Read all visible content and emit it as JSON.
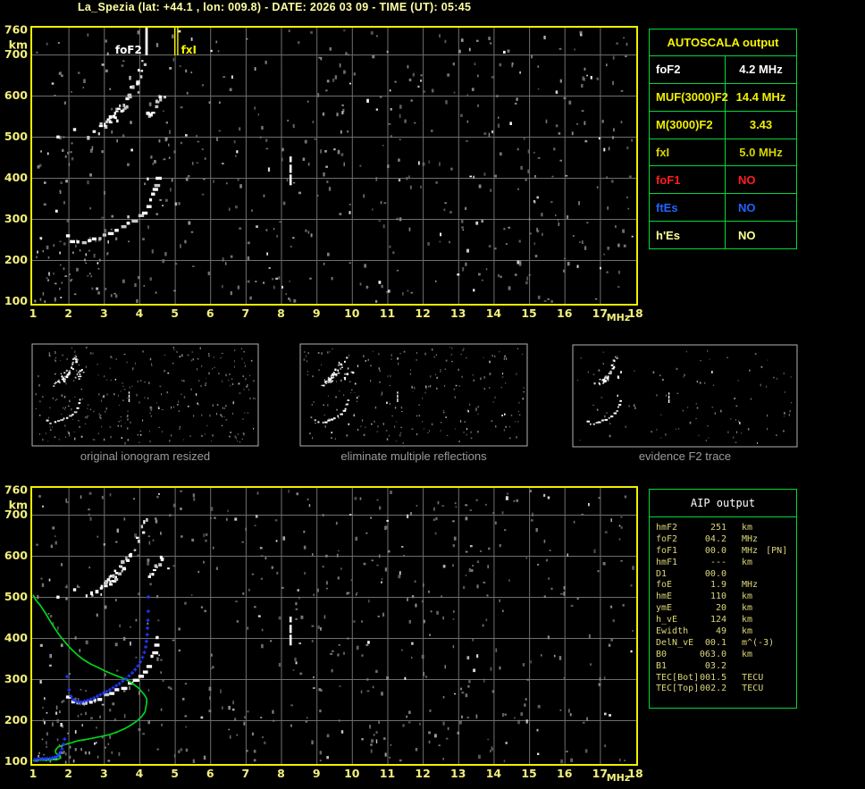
{
  "title": "La_Spezia (lat: +44.1 , lon: 009.8) - DATE: 2026 03 09 - TIME (UT): 05:45",
  "colors": {
    "background": "#000000",
    "title": "#ffffa2",
    "plot_border": "#f0f000",
    "grid": "#6e6e6e",
    "axis_labels": "#f3ef7c",
    "trace": "#ffffff",
    "trace_dim": "#c8c8c8",
    "noise": "#8c8c8c",
    "green_profile": "#00d41e",
    "blue_model": "#2238ff",
    "table_border": "#00d83c",
    "thumb_border": "#b2b2b2",
    "caption": "#9b9b9b",
    "fof2_marker": "#ffffff",
    "fxi_marker": "#f0f000",
    "interference": "#ffffff"
  },
  "autoscala_table": {
    "header": "AUTOSCALA output",
    "rows": [
      {
        "label": "foF2",
        "value": "4.2 MHz",
        "color": "#ffffff",
        "align": "center"
      },
      {
        "label": "MUF(3000)F2",
        "value": "14.4 MHz",
        "color": "#f0f000",
        "align": "center"
      },
      {
        "label": "M(3000)F2",
        "value": "3.43",
        "color": "#f0f000",
        "align": "center"
      },
      {
        "label": "fxI",
        "value": "5.0 MHz",
        "color": "#d6d600",
        "align": "center"
      },
      {
        "label": "foF1",
        "value": "NO",
        "color": "#ff1e1e",
        "align": "left"
      },
      {
        "label": "ftEs",
        "value": "NO",
        "color": "#1e64ff",
        "align": "left"
      },
      {
        "label": "h'Es",
        "value": "NO",
        "color": "#ffff96",
        "align": "left"
      }
    ]
  },
  "aip_table": {
    "header": "AIP output",
    "rows": [
      {
        "name": "hmF2",
        "value": "251",
        "unit": "km",
        "note": ""
      },
      {
        "name": "foF2",
        "value": "04.2",
        "unit": "MHz",
        "note": ""
      },
      {
        "name": "foF1",
        "value": "00.0",
        "unit": "MHz",
        "note": "[PN]"
      },
      {
        "name": "hmF1",
        "value": "---",
        "unit": "km",
        "note": ""
      },
      {
        "name": "D1",
        "value": "00.0",
        "unit": "",
        "note": ""
      },
      {
        "name": "foE",
        "value": "1.9",
        "unit": "MHz",
        "note": ""
      },
      {
        "name": "hmE",
        "value": "110",
        "unit": "km",
        "note": ""
      },
      {
        "name": "ymE",
        "value": "20",
        "unit": "km",
        "note": ""
      },
      {
        "name": "h_vE",
        "value": "124",
        "unit": "km",
        "note": ""
      },
      {
        "name": "Ewidth",
        "value": "49",
        "unit": "km",
        "note": ""
      },
      {
        "name": "DelN_vE",
        "value": "00.1",
        "unit": "m^(-3)",
        "note": ""
      },
      {
        "name": "B0",
        "value": "063.0",
        "unit": "km",
        "note": ""
      },
      {
        "name": "B1",
        "value": "03.2",
        "unit": "",
        "note": ""
      },
      {
        "name": "TEC[Bot]",
        "value": "001.5",
        "unit": "TECU",
        "note": ""
      },
      {
        "name": "TEC[Top]",
        "value": "002.2",
        "unit": "TECU",
        "note": ""
      }
    ]
  },
  "thumbnails": [
    {
      "caption": "original ionogram resized"
    },
    {
      "caption": "eliminate multiple reflections"
    },
    {
      "caption": "evidence F2 trace"
    }
  ],
  "chart_data": {
    "type": "scatter",
    "title": "ionogram: virtual height vs sounding frequency",
    "x_axis": {
      "label": "MHz",
      "min": 1,
      "max": 18,
      "ticks": [
        1,
        2,
        3,
        4,
        5,
        6,
        7,
        8,
        9,
        10,
        11,
        12,
        13,
        14,
        15,
        16,
        17,
        18
      ]
    },
    "y_axis": {
      "label": "km",
      "min": 100,
      "max": 760,
      "ticks": [
        760,
        700,
        600,
        500,
        400,
        300,
        200,
        100
      ]
    },
    "markers": {
      "foF2": {
        "label": "foF2",
        "mhz": 4.2
      },
      "fxI": {
        "label": "fxI",
        "mhz": 5.0
      }
    },
    "f2_trace": [
      [
        1.93,
        257
      ],
      [
        2.0,
        250
      ],
      [
        2.08,
        246
      ],
      [
        2.18,
        243
      ],
      [
        2.3,
        242
      ],
      [
        2.42,
        243
      ],
      [
        2.55,
        246
      ],
      [
        2.7,
        250
      ],
      [
        2.85,
        255
      ],
      [
        3.0,
        260
      ],
      [
        3.15,
        266
      ],
      [
        3.3,
        272
      ],
      [
        3.45,
        278
      ],
      [
        3.6,
        285
      ],
      [
        3.75,
        292
      ],
      [
        3.88,
        300
      ],
      [
        4.0,
        309
      ],
      [
        4.1,
        319
      ],
      [
        4.2,
        332
      ],
      [
        4.28,
        347
      ],
      [
        4.35,
        363
      ],
      [
        4.41,
        381
      ],
      [
        4.46,
        399
      ],
      [
        4.5,
        412
      ]
    ],
    "second_hop_trace": [
      [
        2.55,
        505
      ],
      [
        2.65,
        512
      ],
      [
        2.78,
        516
      ],
      [
        2.86,
        524
      ],
      [
        2.95,
        532
      ],
      [
        3.05,
        540
      ],
      [
        3.15,
        549
      ],
      [
        3.25,
        557
      ],
      [
        3.35,
        566
      ],
      [
        3.45,
        575
      ],
      [
        3.55,
        585
      ],
      [
        3.63,
        596
      ],
      [
        3.72,
        608
      ],
      [
        3.8,
        621
      ],
      [
        3.88,
        634
      ],
      [
        3.95,
        648
      ],
      [
        4.02,
        662
      ],
      [
        4.08,
        676
      ],
      [
        4.13,
        688
      ],
      [
        3.05,
        536
      ],
      [
        3.15,
        543
      ],
      [
        3.28,
        552
      ],
      [
        3.38,
        560
      ],
      [
        3.48,
        570
      ],
      [
        3.3,
        545
      ],
      [
        3.2,
        538
      ],
      [
        3.55,
        578
      ],
      [
        3.42,
        565
      ],
      [
        4.22,
        556
      ],
      [
        4.3,
        563
      ],
      [
        4.38,
        572
      ],
      [
        4.47,
        582
      ],
      [
        4.55,
        592
      ],
      [
        4.62,
        601
      ]
    ],
    "e_trace": [
      [
        1.02,
        103
      ],
      [
        1.1,
        104
      ],
      [
        1.18,
        104
      ],
      [
        1.27,
        105
      ],
      [
        1.35,
        105
      ],
      [
        1.44,
        106
      ],
      [
        1.52,
        106
      ],
      [
        1.6,
        107
      ],
      [
        1.68,
        109
      ],
      [
        1.73,
        118
      ],
      [
        1.76,
        127
      ]
    ],
    "interference": {
      "mhz": 8.27,
      "km_segments": [
        [
          382,
          408
        ],
        [
          412,
          432
        ],
        [
          438,
          452
        ]
      ]
    },
    "bright_specks": [
      [
        1.66,
        503
      ],
      [
        2.13,
        521
      ]
    ],
    "profile_green": [
      [
        1.0,
        505
      ],
      [
        1.08,
        492
      ],
      [
        1.2,
        480
      ],
      [
        1.33,
        463
      ],
      [
        1.45,
        446
      ],
      [
        1.6,
        425
      ],
      [
        1.76,
        405
      ],
      [
        1.92,
        388
      ],
      [
        2.09,
        372
      ],
      [
        2.25,
        359
      ],
      [
        2.41,
        348
      ],
      [
        2.62,
        337
      ],
      [
        2.84,
        328
      ],
      [
        3.05,
        319
      ],
      [
        3.27,
        311
      ],
      [
        3.45,
        305
      ],
      [
        3.6,
        300
      ],
      [
        3.78,
        291
      ],
      [
        3.98,
        278
      ],
      [
        4.13,
        263
      ],
      [
        4.19,
        255
      ],
      [
        4.21,
        250
      ],
      [
        4.2,
        240
      ],
      [
        4.16,
        220
      ],
      [
        4.06,
        208
      ],
      [
        3.93,
        198
      ],
      [
        3.78,
        189
      ],
      [
        3.6,
        180
      ],
      [
        3.39,
        172
      ],
      [
        3.17,
        165
      ],
      [
        2.95,
        161
      ],
      [
        2.72,
        157
      ],
      [
        2.49,
        153
      ],
      [
        2.26,
        150
      ],
      [
        2.08,
        145
      ],
      [
        1.91,
        141
      ],
      [
        1.71,
        135
      ],
      [
        1.63,
        126
      ],
      [
        1.64,
        120
      ],
      [
        1.7,
        116
      ],
      [
        1.77,
        113
      ],
      [
        1.78,
        108
      ],
      [
        1.7,
        105
      ],
      [
        1.58,
        104
      ],
      [
        1.4,
        103
      ],
      [
        1.25,
        103
      ],
      [
        1.0,
        102
      ]
    ],
    "model_trace_blue": [
      [
        1.05,
        104
      ],
      [
        1.12,
        105
      ],
      [
        1.19,
        105
      ],
      [
        1.26,
        106
      ],
      [
        1.33,
        106
      ],
      [
        1.4,
        107
      ],
      [
        1.47,
        107
      ],
      [
        1.54,
        108
      ],
      [
        1.61,
        110
      ],
      [
        1.68,
        112
      ],
      [
        1.73,
        116
      ],
      [
        1.78,
        122
      ],
      [
        1.82,
        130
      ],
      [
        1.86,
        141
      ],
      [
        1.89,
        154
      ],
      [
        1.96,
        306
      ],
      [
        2.02,
        274
      ],
      [
        2.07,
        258
      ],
      [
        2.13,
        250
      ],
      [
        2.2,
        246
      ],
      [
        2.28,
        244
      ],
      [
        2.36,
        244
      ],
      [
        2.45,
        246
      ],
      [
        2.54,
        248
      ],
      [
        2.63,
        251
      ],
      [
        2.72,
        254
      ],
      [
        2.81,
        258
      ],
      [
        2.9,
        262
      ],
      [
        2.99,
        266
      ],
      [
        3.08,
        270
      ],
      [
        3.17,
        274
      ],
      [
        3.26,
        279
      ],
      [
        3.35,
        284
      ],
      [
        3.44,
        289
      ],
      [
        3.53,
        295
      ],
      [
        3.62,
        301
      ],
      [
        3.71,
        308
      ],
      [
        3.8,
        315
      ],
      [
        3.88,
        323
      ],
      [
        3.96,
        332
      ],
      [
        4.03,
        342
      ],
      [
        4.09,
        353
      ],
      [
        4.14,
        365
      ],
      [
        4.18,
        378
      ],
      [
        4.2,
        392
      ],
      [
        4.22,
        408
      ],
      [
        4.23,
        424
      ],
      [
        4.24,
        443
      ],
      [
        4.25,
        465
      ],
      [
        4.26,
        500
      ]
    ],
    "noise": {
      "seed": 1337,
      "main_count": 540,
      "cluster_count": 45,
      "thumb_counts": [
        290,
        225,
        100
      ]
    }
  }
}
